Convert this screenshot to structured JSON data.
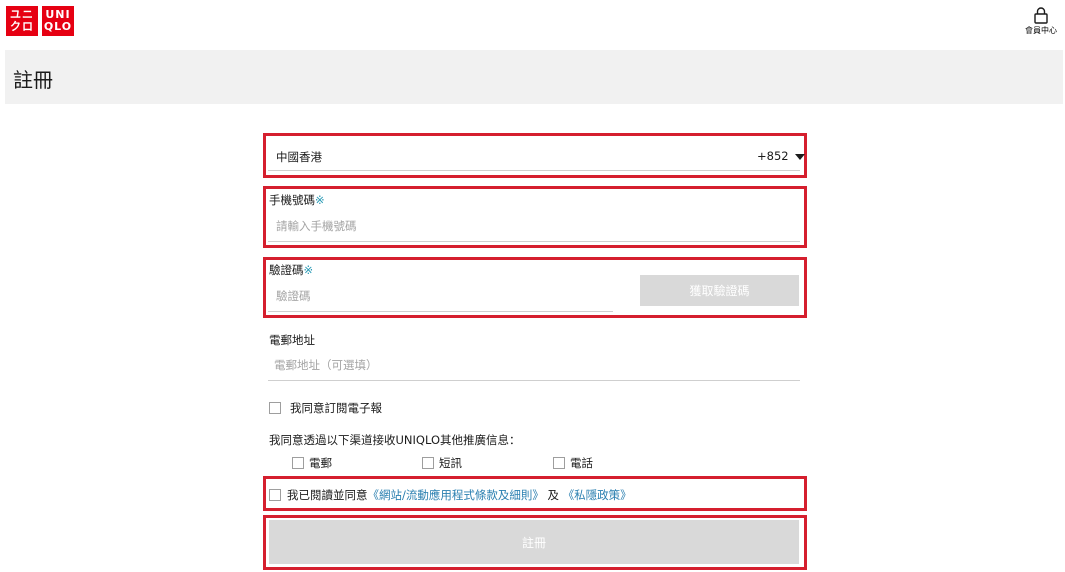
{
  "header": {
    "logo_line1_left": "ユニ",
    "logo_line2_left": "クロ",
    "logo_line1_right": "UNI",
    "logo_line2_right": "QLO",
    "member_label": "會員中心"
  },
  "page": {
    "title": "註冊"
  },
  "form": {
    "country_name": "中國香港",
    "country_code": "+852",
    "phone_label": "手機號碼",
    "required_mark": "※",
    "phone_placeholder": "請輸入手機號碼",
    "otp_label": "驗證碼",
    "otp_placeholder": "驗證碼",
    "otp_button": "獲取驗證碼",
    "email_label": "電郵地址",
    "email_placeholder": "電郵地址（可選填）",
    "newsletter_label": "我同意訂閱電子報",
    "channels_label": "我同意透過以下渠道接收UNIQLO其他推廣信息：",
    "channels": [
      {
        "label": "電郵"
      },
      {
        "label": "短訊"
      },
      {
        "label": "電話"
      }
    ],
    "terms_prefix": "我已閱讀並同意",
    "terms_link": "《網站/流動應用程式條款及細則》",
    "terms_and": "及",
    "privacy_link": "《私隱政策》",
    "submit_label": "註冊"
  },
  "colors": {
    "brand_red": "#e60012",
    "highlight_red": "#d51f2e",
    "link_blue": "#2a7fb0",
    "required_teal": "#2a9ab5",
    "disabled_gray": "#d9d9d9"
  }
}
